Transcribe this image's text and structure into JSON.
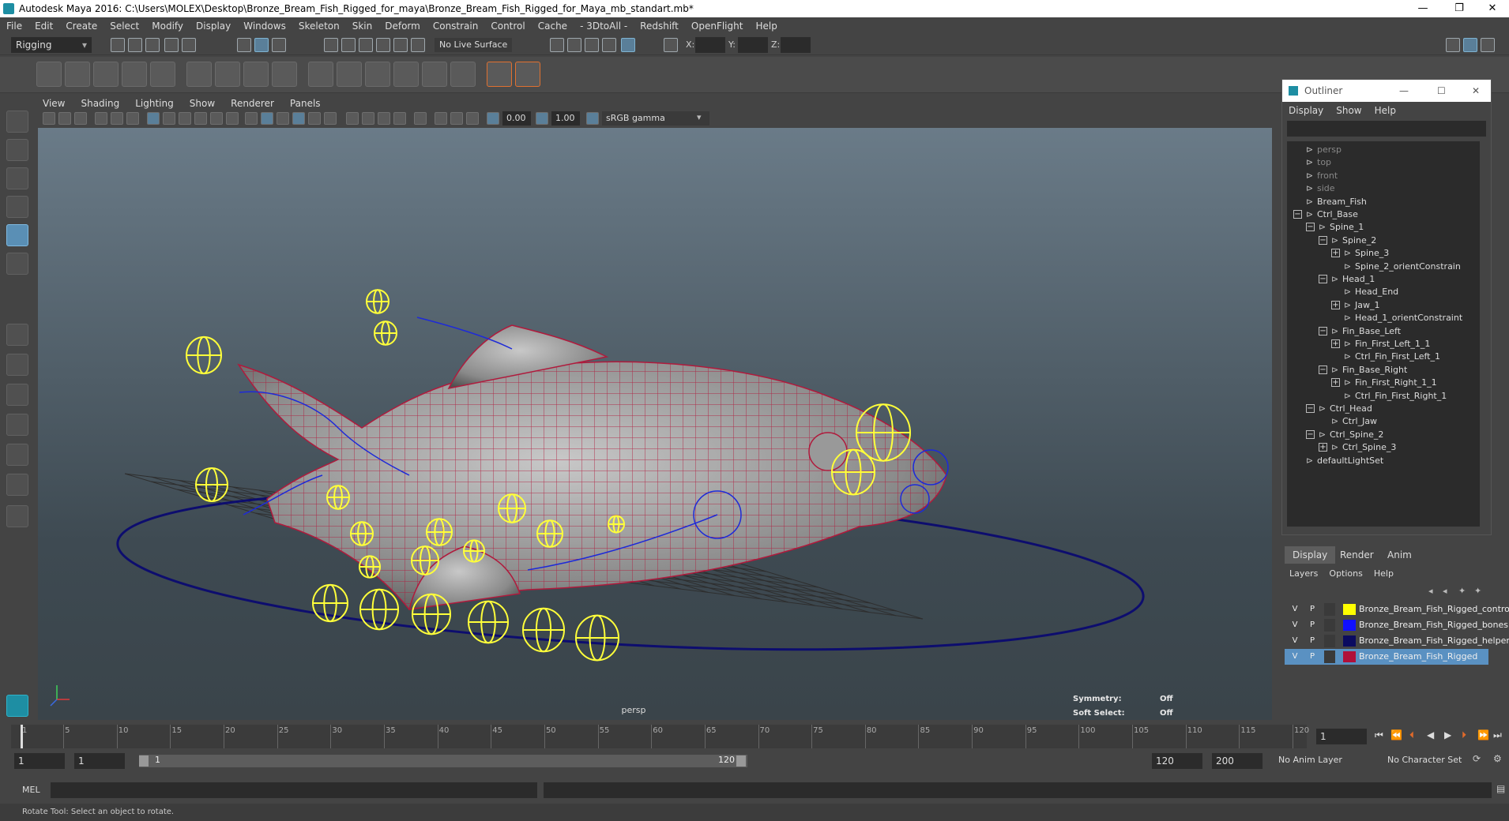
{
  "window": {
    "title": "Autodesk Maya 2016: C:\\Users\\MOLEX\\Desktop\\Bronze_Bream_Fish_Rigged_for_maya\\Bronze_Bream_Fish_Rigged_for_Maya_mb_standart.mb*",
    "minimize": "—",
    "restore": "❐",
    "close": "✕"
  },
  "menubar": [
    "File",
    "Edit",
    "Create",
    "Select",
    "Modify",
    "Display",
    "Windows",
    "Skeleton",
    "Skin",
    "Deform",
    "Constrain",
    "Control",
    "Cache",
    "- 3DtoAll -",
    "Redshift",
    "OpenFlight",
    "Help"
  ],
  "statusline": {
    "mode": "Rigging",
    "live_surface": "No Live Surface",
    "x_label": "X:",
    "y_label": "Y:",
    "z_label": "Z:"
  },
  "panel": {
    "menu": [
      "View",
      "Shading",
      "Lighting",
      "Show",
      "Renderer",
      "Panels"
    ],
    "near_clip": "0.00",
    "far_clip": "1.00",
    "color_space": "sRGB gamma"
  },
  "viewport": {
    "camera": "persp",
    "symmetry_label": "Symmetry:",
    "symmetry_value": "Off",
    "soft_select_label": "Soft Select:",
    "soft_select_value": "Off",
    "colors": {
      "mesh_wire": "#b01a3c",
      "controls": "#ffff3a",
      "bones": "#1e2ad8",
      "base_curve": "#0d0d6e"
    }
  },
  "outliner": {
    "title": "Outliner",
    "menu": [
      "Display",
      "Show",
      "Help"
    ],
    "items": [
      {
        "label": "persp",
        "depth": 0,
        "dim": true,
        "exp": ""
      },
      {
        "label": "top",
        "depth": 0,
        "dim": true,
        "exp": ""
      },
      {
        "label": "front",
        "depth": 0,
        "dim": true,
        "exp": ""
      },
      {
        "label": "side",
        "depth": 0,
        "dim": true,
        "exp": ""
      },
      {
        "label": "Bream_Fish",
        "depth": 0,
        "dim": false,
        "exp": ""
      },
      {
        "label": "Ctrl_Base",
        "depth": 0,
        "dim": false,
        "exp": "−"
      },
      {
        "label": "Spine_1",
        "depth": 1,
        "dim": false,
        "exp": "−"
      },
      {
        "label": "Spine_2",
        "depth": 2,
        "dim": false,
        "exp": "−"
      },
      {
        "label": "Spine_3",
        "depth": 3,
        "dim": false,
        "exp": "+"
      },
      {
        "label": "Spine_2_orientConstrain",
        "depth": 3,
        "dim": false,
        "exp": ""
      },
      {
        "label": "Head_1",
        "depth": 2,
        "dim": false,
        "exp": "−"
      },
      {
        "label": "Head_End",
        "depth": 3,
        "dim": false,
        "exp": ""
      },
      {
        "label": "Jaw_1",
        "depth": 3,
        "dim": false,
        "exp": "+"
      },
      {
        "label": "Head_1_orientConstraint",
        "depth": 3,
        "dim": false,
        "exp": ""
      },
      {
        "label": "Fin_Base_Left",
        "depth": 2,
        "dim": false,
        "exp": "−"
      },
      {
        "label": "Fin_First_Left_1_1",
        "depth": 3,
        "dim": false,
        "exp": "+"
      },
      {
        "label": "Ctrl_Fin_First_Left_1",
        "depth": 3,
        "dim": false,
        "exp": ""
      },
      {
        "label": "Fin_Base_Right",
        "depth": 2,
        "dim": false,
        "exp": "−"
      },
      {
        "label": "Fin_First_Right_1_1",
        "depth": 3,
        "dim": false,
        "exp": "+"
      },
      {
        "label": "Ctrl_Fin_First_Right_1",
        "depth": 3,
        "dim": false,
        "exp": ""
      },
      {
        "label": "Ctrl_Head",
        "depth": 1,
        "dim": false,
        "exp": "−"
      },
      {
        "label": "Ctrl_Jaw",
        "depth": 2,
        "dim": false,
        "exp": ""
      },
      {
        "label": "Ctrl_Spine_2",
        "depth": 1,
        "dim": false,
        "exp": "−"
      },
      {
        "label": "Ctrl_Spine_3",
        "depth": 2,
        "dim": false,
        "exp": "+"
      },
      {
        "label": "defaultLightSet",
        "depth": 0,
        "dim": false,
        "exp": ""
      }
    ]
  },
  "layer_editor": {
    "tabs": [
      "Display",
      "Render",
      "Anim"
    ],
    "menu": [
      "Layers",
      "Options",
      "Help"
    ],
    "layers": [
      {
        "v": "V",
        "p": "P",
        "color": "#ffff00",
        "name": "Bronze_Bream_Fish_Rigged_controllers",
        "selected": false
      },
      {
        "v": "V",
        "p": "P",
        "color": "#1010ff",
        "name": "Bronze_Bream_Fish_Rigged_bones",
        "selected": false
      },
      {
        "v": "V",
        "p": "P",
        "color": "#0b0b60",
        "name": "Bronze_Bream_Fish_Rigged_helpers",
        "selected": false
      },
      {
        "v": "V",
        "p": "P",
        "color": "#b0103a",
        "name": "Bronze_Bream_Fish_Rigged",
        "selected": true
      }
    ]
  },
  "timeline": {
    "ticks": [
      "1",
      "5",
      "10",
      "15",
      "20",
      "25",
      "30",
      "35",
      "40",
      "45",
      "50",
      "55",
      "60",
      "65",
      "70",
      "75",
      "80",
      "85",
      "90",
      "95",
      "100",
      "105",
      "110",
      "115",
      "120"
    ],
    "current_frame": "1"
  },
  "range": {
    "start": "1",
    "playback_start": "1",
    "slider_start": "1",
    "slider_end": "120",
    "playback_end": "120",
    "end": "200",
    "anim_layer": "No Anim Layer",
    "character_set": "No Character Set"
  },
  "cmdline": {
    "label": "MEL"
  },
  "helpline": {
    "text": "Rotate Tool: Select an object to rotate."
  }
}
